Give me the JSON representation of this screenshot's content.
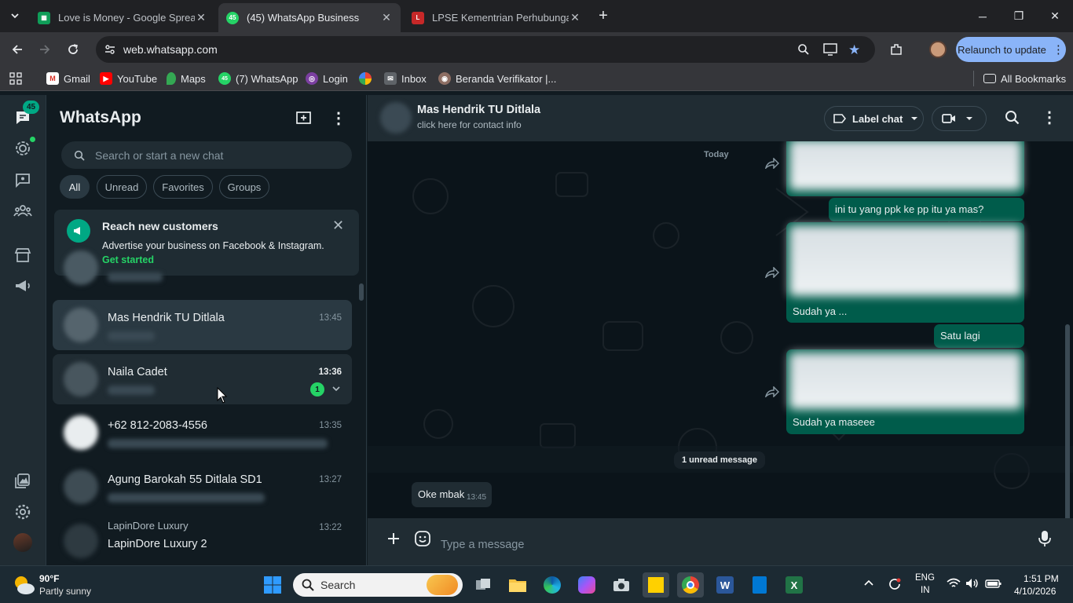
{
  "browser": {
    "tabs": [
      {
        "title": "Love is Money - Google Spread",
        "active": false
      },
      {
        "title": "(45) WhatsApp Business",
        "active": true,
        "badge": "45"
      },
      {
        "title": "LPSE Kementrian Perhubungan",
        "active": false
      }
    ],
    "url": "web.whatsapp.com",
    "relaunch_label": "Relaunch to update",
    "bookmarks": [
      "Gmail",
      "YouTube",
      "Maps",
      "(7) WhatsApp",
      "Login",
      "Inbox",
      "Beranda Verifikator |..."
    ],
    "all_bookmarks_label": "All Bookmarks"
  },
  "whatsapp": {
    "rail_badge": "45",
    "title": "WhatsApp",
    "search_placeholder": "Search or start a new chat",
    "filters": [
      "All",
      "Unread",
      "Favorites",
      "Groups"
    ],
    "promo": {
      "title": "Reach new customers",
      "text": "Advertise your business on Facebook & Instagram.",
      "link": "Get started"
    },
    "chats": [
      {
        "name": "Mas Hendrik TU Ditlala",
        "time": "13:45",
        "selected": true
      },
      {
        "name": "Naila Cadet",
        "time": "13:36",
        "unread": "1",
        "hover": true
      },
      {
        "name": "+62 812-2083-4556",
        "time": "13:35"
      },
      {
        "name": "Agung Barokah 55 Ditlala SD1",
        "time": "13:27"
      },
      {
        "group": "LapinDore Luxury",
        "name": "LapinDore Luxury 2",
        "time": "13:22"
      }
    ],
    "header": {
      "name": "Mas Hendrik TU Ditlala",
      "subtitle": "click here for contact info",
      "label_chat": "Label chat"
    },
    "conversation": {
      "date_chip": "Today",
      "messages": [
        {
          "text": "ini tu yang ppk ke pp itu ya mas?"
        },
        {
          "text": "Sudah ya ..."
        },
        {
          "text": "Satu lagi"
        },
        {
          "text": "Sudah ya maseee"
        }
      ],
      "unread_label": "1 unread message",
      "incoming": {
        "text": "Oke mbak",
        "time": "13:45"
      }
    },
    "composer_placeholder": "Type a message"
  },
  "taskbar": {
    "weather_temp": "90°F",
    "weather_desc": "Partly sunny",
    "search_label": "Search",
    "lang": "ENG",
    "region": "IN",
    "time": "1:51 PM",
    "date": "4/10/2026"
  }
}
